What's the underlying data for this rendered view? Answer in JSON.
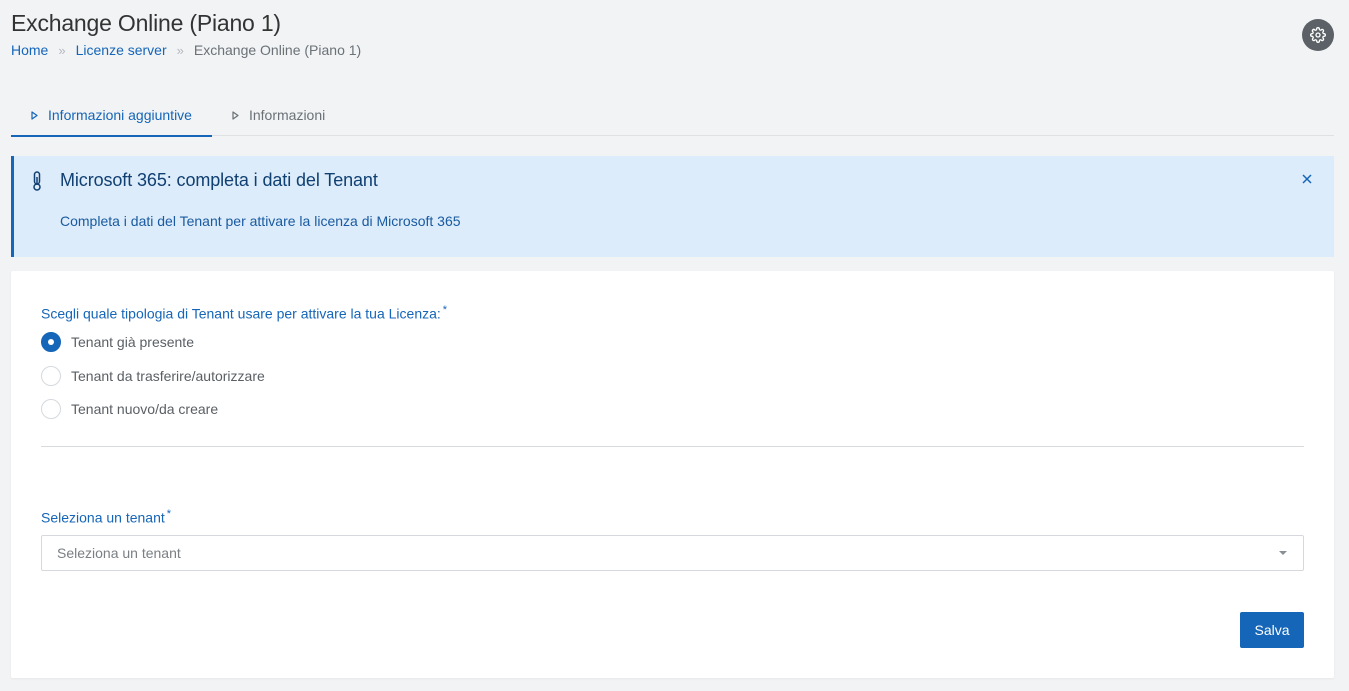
{
  "header": {
    "title": "Exchange Online (Piano 1)",
    "breadcrumb": [
      {
        "label": "Home"
      },
      {
        "label": "Licenze server"
      },
      {
        "label": "Exchange Online (Piano 1)"
      }
    ],
    "breadcrumb_separator": "»",
    "settings_icon": "gear-icon"
  },
  "tabs": [
    {
      "label": "Informazioni aggiuntive",
      "active": true
    },
    {
      "label": "Informazioni",
      "active": false
    }
  ],
  "alert": {
    "icon": "thermometer-icon",
    "title": "Microsoft 365: completa i dati del Tenant",
    "text": "Completa i dati del Tenant per attivare la licenza di Microsoft 365",
    "close_icon": "close-icon"
  },
  "form": {
    "tenant_type": {
      "label": "Scegli quale tipologia di Tenant usare per attivare la tua Licenza:",
      "required_mark": "*",
      "options": [
        {
          "label": "Tenant già presente",
          "checked": true
        },
        {
          "label": "Tenant da trasferire/autorizzare",
          "checked": false
        },
        {
          "label": "Tenant nuovo/da creare",
          "checked": false
        }
      ]
    },
    "tenant_select": {
      "label": "Seleziona un tenant",
      "required_mark": "*",
      "placeholder": "Seleziona un tenant"
    },
    "save_label": "Salva"
  },
  "colors": {
    "primary": "#1565b8",
    "alert_bg": "#dcecfa",
    "page_bg": "#f1f3f4"
  }
}
